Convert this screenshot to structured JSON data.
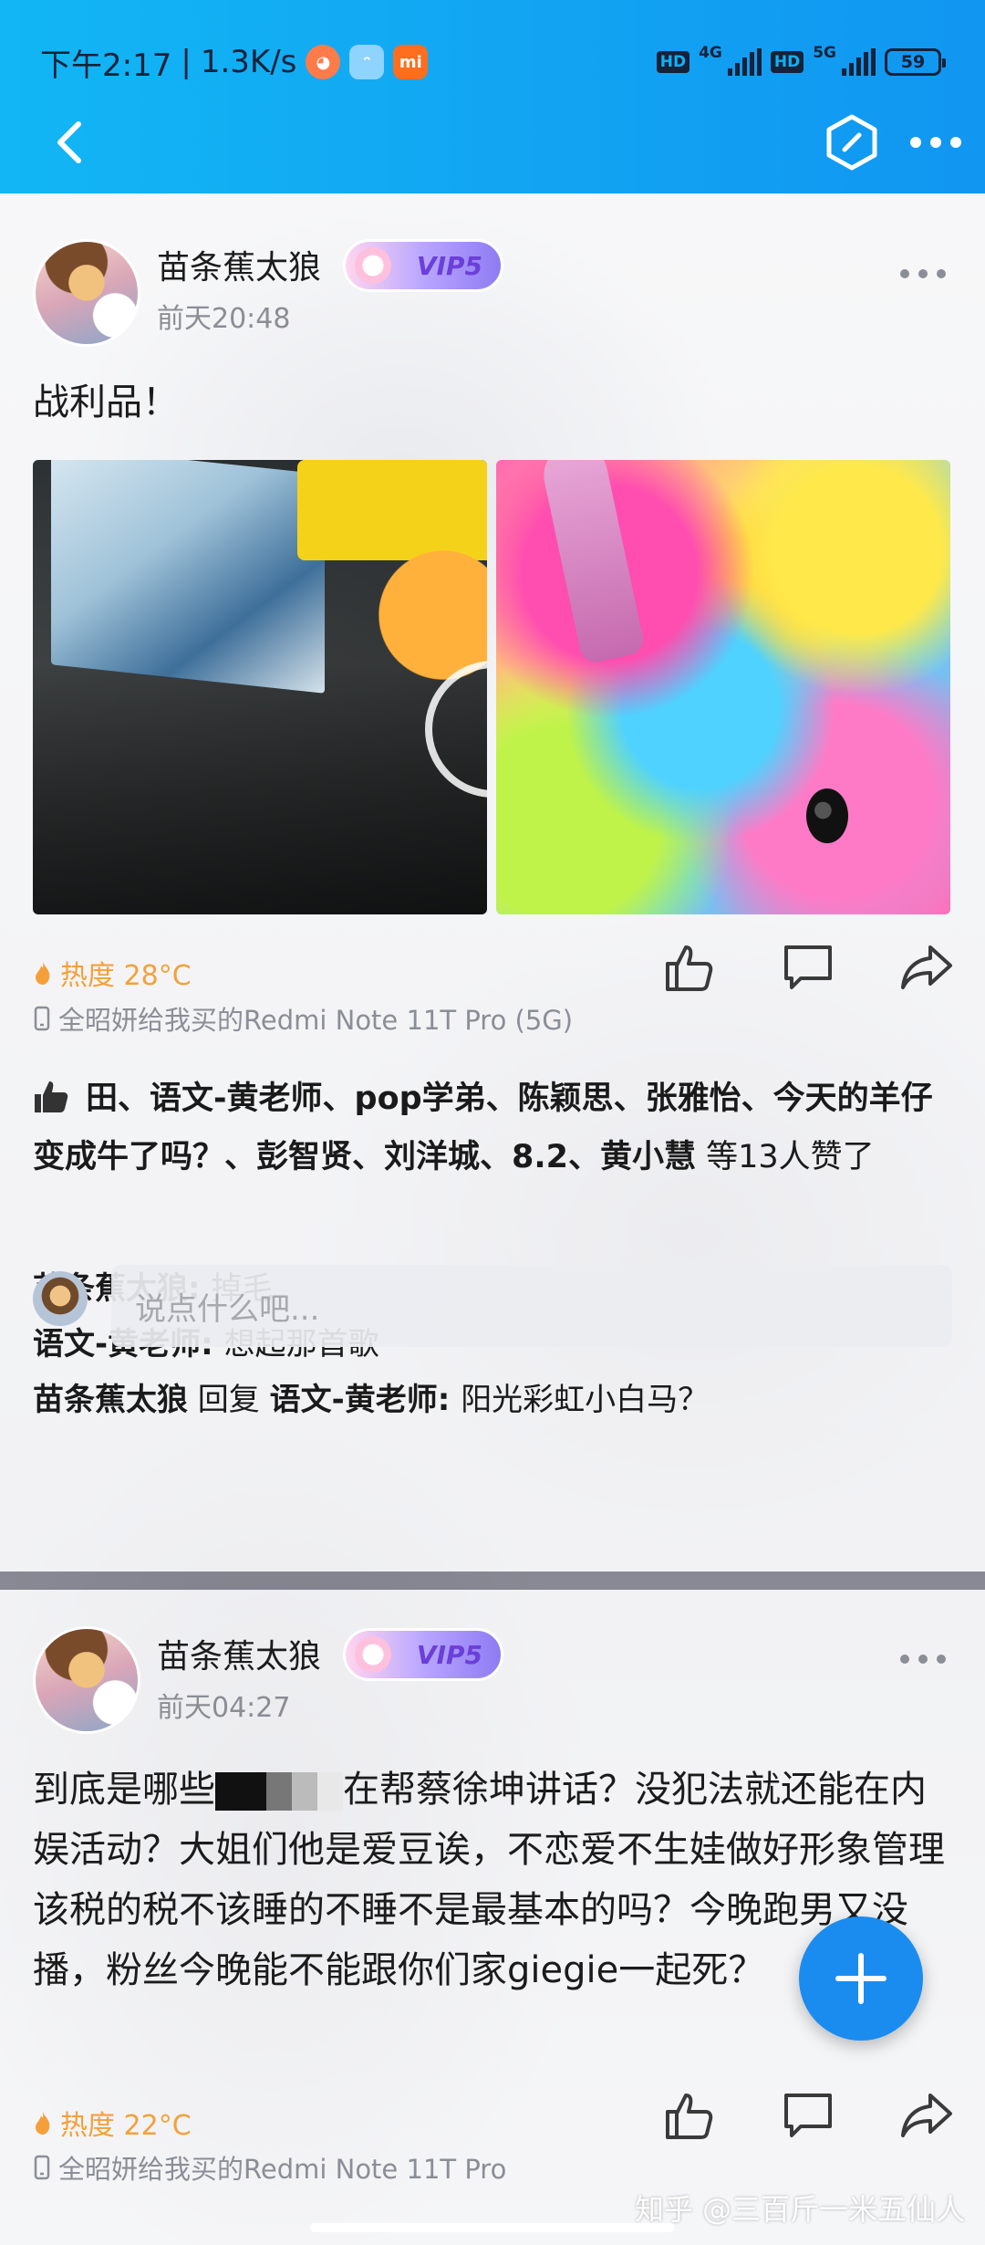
{
  "status_bar": {
    "time": "下午2:17",
    "speed": "1.3K/s",
    "hd": "HD",
    "net1": "4G",
    "net2": "5G",
    "battery": "59"
  },
  "app_icons": [
    {
      "name": "panda-app-icon",
      "color": "#ff7b4a"
    },
    {
      "name": "cat-app-icon",
      "color": "#8fd3ff"
    },
    {
      "name": "mi-app-icon",
      "color": "#ff6d1f"
    }
  ],
  "posts": [
    {
      "author": "苗条蕉太狼",
      "vip": "VIP5",
      "time": "前天20:48",
      "text": "战利品！",
      "heat": "热度 28°C",
      "device": "全昭妍给我买的Redmi Note 11T Pro (5G)",
      "likes_names": "田、语文-黄老师、pop学弟、陈颖思、张雅怡、今天的羊仔 变成牛了吗？、彭智贤、刘洋城、8.2、黄小慧",
      "likes_suffix": " 等13人赞了",
      "comments": [
        {
          "user": "苗条蕉太狼",
          "text": "掉毛"
        },
        {
          "user": "语文-黄老师",
          "text": "想起那首歌"
        },
        {
          "user": "苗条蕉太狼",
          "reply_word": " 回复 ",
          "target": "语文-黄老师",
          "text": "阳光彩虹小白马？"
        }
      ],
      "comment_placeholder": "说点什么吧..."
    },
    {
      "author": "苗条蕉太狼",
      "vip": "VIP5",
      "time": "前天04:27",
      "text_before": "到底是哪些",
      "text_after": "在帮蔡徐坤讲话？没犯法就还能在内娱活动？大姐们他是爱豆诶，不恋爱不生娃做好形象管理该税的税不该睡的不睡不是最基本的吗？今晚跑男又没播，粉丝今晚能不能跟你们家giegie一起死？",
      "heat": "热度 22°C",
      "device": "全昭妍给我买的Redmi Note 11T Pro"
    }
  ],
  "watermark": "知乎 @三百斤一米五仙人",
  "colors": {
    "topbar": "#12b6f4",
    "heat": "#f4a03a",
    "fab": "#1a8cf0"
  }
}
